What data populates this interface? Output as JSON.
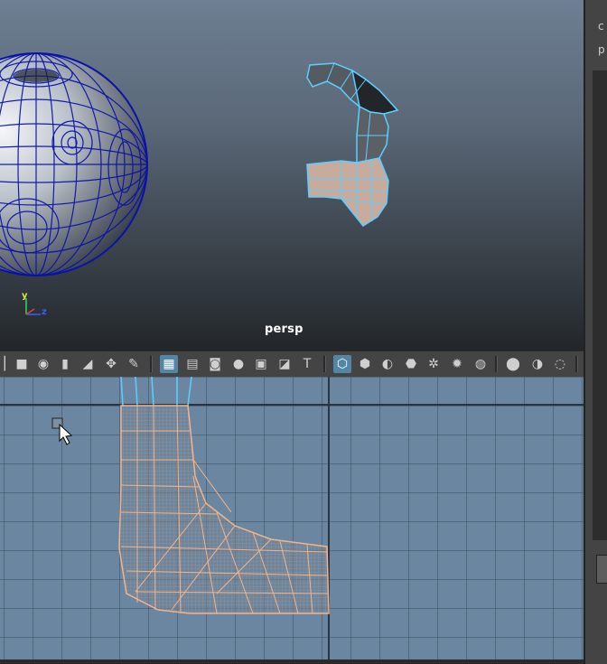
{
  "viewport": {
    "camera_label": "persp",
    "axis_y_label": "y",
    "axis_z_label": "z"
  },
  "right_panel": {
    "line1": "c",
    "line2": "p"
  },
  "toolbar": {
    "icons": [
      "camera-icon",
      "camera-attributes-icon",
      "bookmark-icon",
      "image-plane-icon",
      "2d-pan-icon",
      "grease-pencil-icon",
      "grid-icon",
      "film-gate-icon",
      "resolution-gate-icon",
      "gate-mask-icon",
      "field-chart-icon",
      "safe-action-icon",
      "safe-title-icon",
      "wireframe-icon",
      "smooth-shade-icon",
      "shade-wireframe-icon",
      "textured-icon",
      "xray-icon",
      "use-lights-icon",
      "shadows-icon",
      "isolate-select-icon",
      "xray-joints-icon",
      "xray-active-icon"
    ],
    "active_icons": [
      "grid-icon",
      "wireframe-icon"
    ]
  },
  "colors": {
    "selection": "#5ad0ff",
    "uv_mesh": "#f3b48a",
    "uv_background": "#6b86a0",
    "sphere_wire": "#0a12a8"
  }
}
